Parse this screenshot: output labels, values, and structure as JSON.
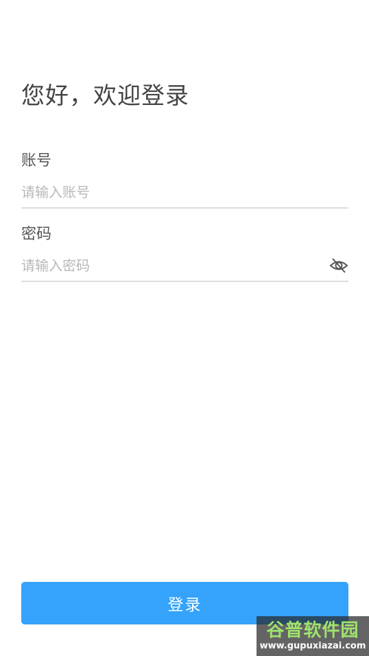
{
  "page": {
    "title": "您好，欢迎登录"
  },
  "form": {
    "account": {
      "label": "账号",
      "placeholder": "请输入账号",
      "value": ""
    },
    "password": {
      "label": "密码",
      "placeholder": "请输入密码",
      "value": "",
      "toggle_icon": "eye-off-icon"
    }
  },
  "actions": {
    "login_label": "登录"
  },
  "watermark": {
    "title": "谷普软件园",
    "url": "www.gupuxiazai.com"
  },
  "colors": {
    "primary": "#35a3fb",
    "text_dark": "#444444",
    "text_label": "#555555",
    "placeholder": "#b8b8b8",
    "divider": "#dddddd"
  }
}
